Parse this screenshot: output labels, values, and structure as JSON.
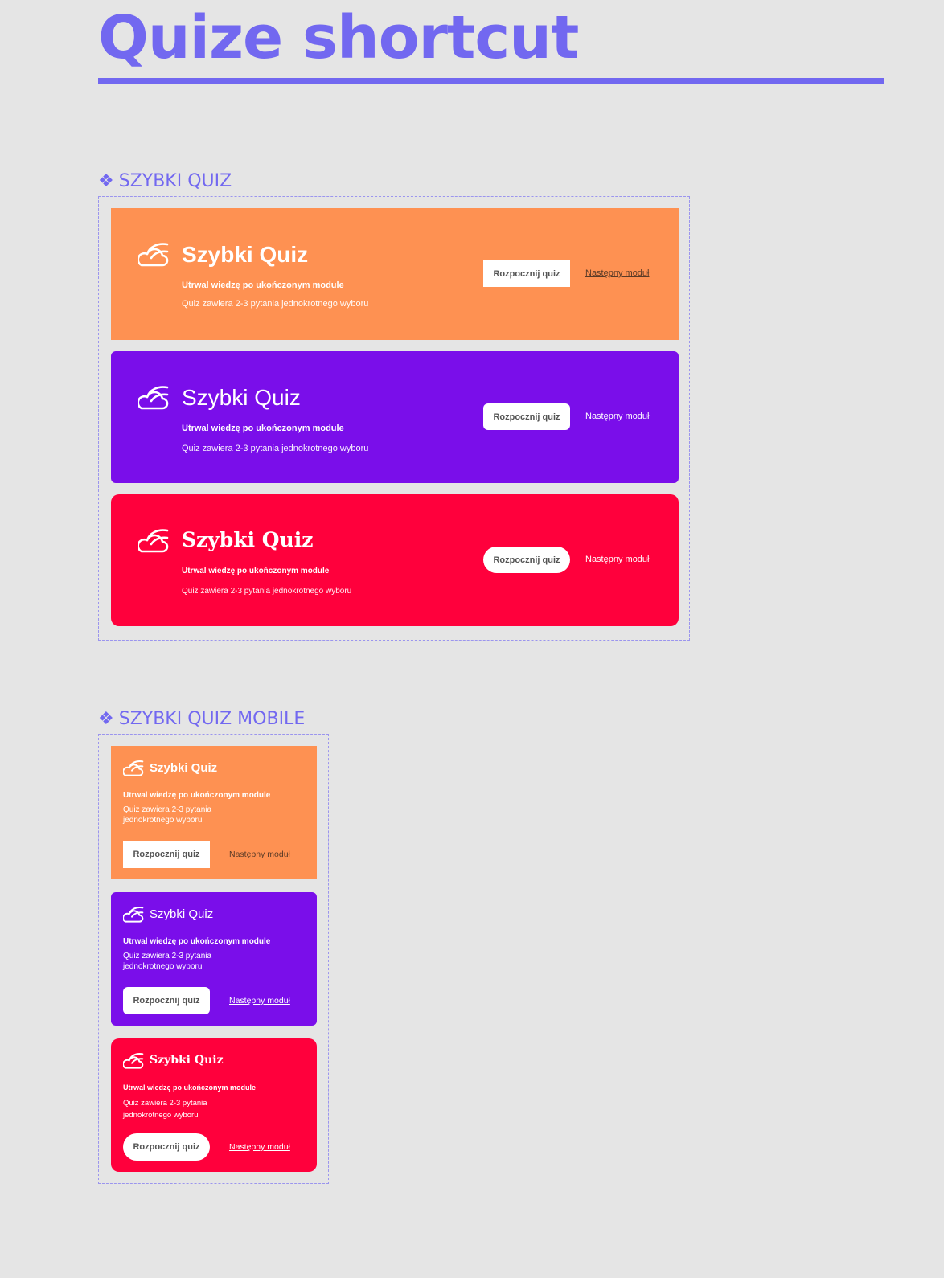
{
  "page": {
    "title": "Quize shortcut"
  },
  "sections": {
    "desktop": {
      "label": "SZYBKI QUIZ"
    },
    "mobile": {
      "label": "SZYBKI QUIZ MOBILE"
    }
  },
  "colors": {
    "accent": "#7268f0",
    "orange": "#fe9152",
    "purple": "#7a0eea",
    "red": "#ff003c"
  },
  "card": {
    "title": "Szybki Quiz",
    "subtitle": "Utrwal wiedzę po ukończonym module",
    "description": "Quiz zawiera 2-3 pytania jednokrotnego wyboru",
    "description_mobile_line1": "Quiz zawiera 2-3 pytania",
    "description_mobile_line2": "jednokrotnego wyboru",
    "start_button": "Rozpocznij quiz",
    "next_link": "Następny moduł",
    "icon": "cloud-quiz-icon"
  }
}
